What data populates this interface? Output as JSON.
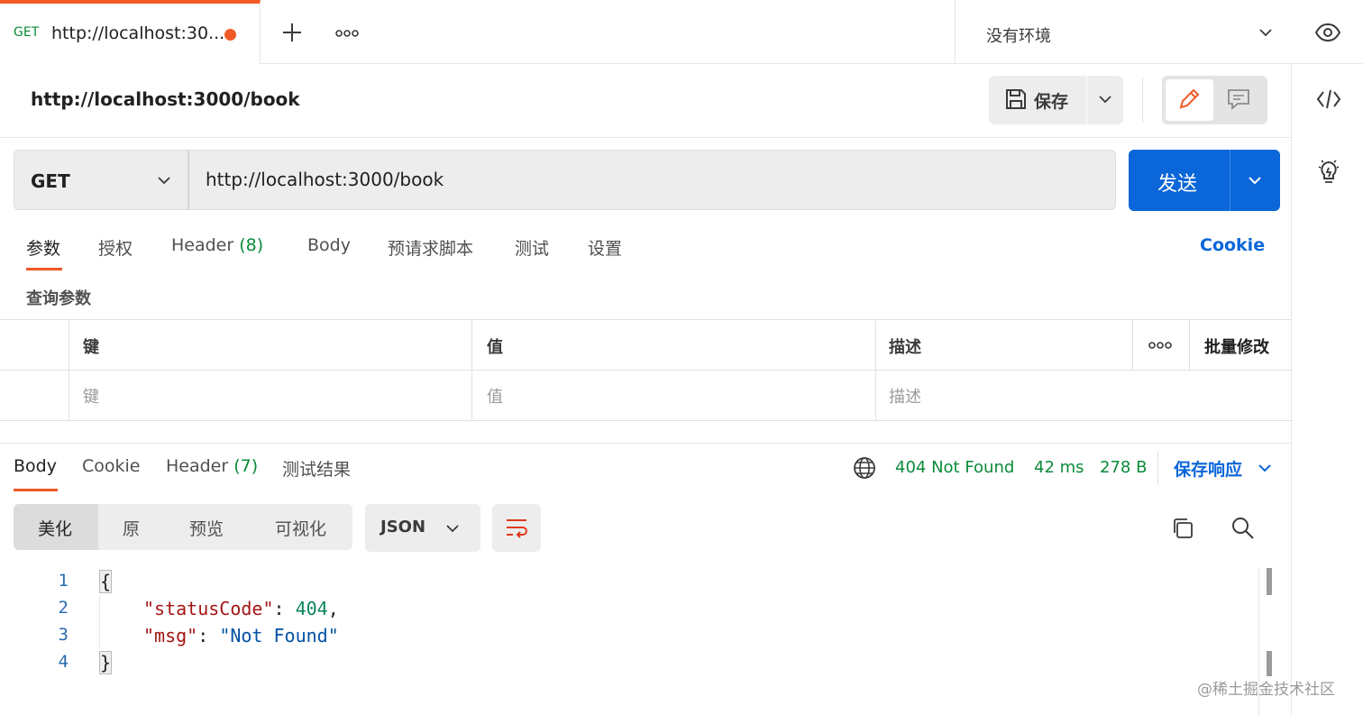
{
  "tab": {
    "method": "GET",
    "title": "http://localhost:30...",
    "unsaved_color": "#f05a28"
  },
  "env": {
    "label": "没有环境"
  },
  "request": {
    "title": "http://localhost:3000/book",
    "save_label": "保存",
    "method": "GET",
    "url": "http://localhost:3000/book",
    "send_label": "发送",
    "tabs": [
      {
        "label": "参数",
        "count": ""
      },
      {
        "label": "授权",
        "count": ""
      },
      {
        "label": "Header",
        "count": "(8)"
      },
      {
        "label": "Body",
        "count": ""
      },
      {
        "label": "预请求脚本",
        "count": ""
      },
      {
        "label": "测试",
        "count": ""
      },
      {
        "label": "设置",
        "count": ""
      }
    ],
    "cookie_link": "Cookie"
  },
  "params": {
    "section_label": "查询参数",
    "headers": {
      "key": "键",
      "value": "值",
      "desc": "描述",
      "bulk": "批量修改"
    },
    "placeholders": {
      "key": "键",
      "value": "值",
      "desc": "描述"
    }
  },
  "response": {
    "tabs": [
      {
        "label": "Body",
        "count": ""
      },
      {
        "label": "Cookie",
        "count": ""
      },
      {
        "label": "Header",
        "count": "(7)"
      },
      {
        "label": "测试结果",
        "count": ""
      }
    ],
    "status": "404 Not Found",
    "time": "42 ms",
    "size": "278 B",
    "save_label": "保存响应",
    "views": [
      "美化",
      "原",
      "预览",
      "可视化"
    ],
    "format": "JSON",
    "code_lines": [
      {
        "no": "1",
        "open": "{"
      },
      {
        "no": "2",
        "key": "\"statusCode\"",
        "sep": ": ",
        "value": "404",
        "tail": ","
      },
      {
        "no": "3",
        "key": "\"msg\"",
        "sep": ": ",
        "value": "\"Not Found\"",
        "tail": ""
      },
      {
        "no": "4",
        "close": "}"
      }
    ]
  },
  "watermark": "@稀土掘金技术社区",
  "colors": {
    "accent": "#f05a28",
    "primary": "#0a66d9",
    "success": "#0b8a3a"
  }
}
